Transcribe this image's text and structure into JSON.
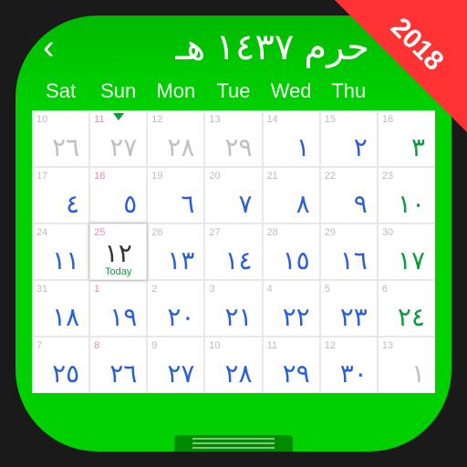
{
  "badge": {
    "year": "2018"
  },
  "header": {
    "title": "حرم ١٤٣٧ هـ"
  },
  "weekdays": [
    "Sat",
    "Sun",
    "Mon",
    "Tue",
    "Wed",
    "Thu"
  ],
  "today_label": "Today",
  "cells": [
    {
      "g": "10",
      "h": "٢٦",
      "hc": "gray"
    },
    {
      "g": "11",
      "gp": true,
      "h": "٢٧",
      "hc": "gray",
      "mark": true
    },
    {
      "g": "12",
      "h": "٢٨",
      "hc": "gray"
    },
    {
      "g": "13",
      "h": "٢٩",
      "hc": "gray"
    },
    {
      "g": "14",
      "h": "١",
      "hc": "blue"
    },
    {
      "g": "15",
      "h": "٢",
      "hc": "blue"
    },
    {
      "g": "17",
      "h": "٤",
      "hc": "blue"
    },
    {
      "g": "18",
      "gp": true,
      "h": "٥",
      "hc": "blue"
    },
    {
      "g": "19",
      "h": "٦",
      "hc": "blue"
    },
    {
      "g": "20",
      "h": "٧",
      "hc": "blue"
    },
    {
      "g": "21",
      "h": "٨",
      "hc": "blue"
    },
    {
      "g": "22",
      "h": "٩",
      "hc": "blue"
    },
    {
      "g": "24",
      "h": "١١",
      "hc": "blue"
    },
    {
      "g": "25",
      "gp": true,
      "h": "١٢",
      "hc": "black",
      "today": true
    },
    {
      "g": "26",
      "h": "١٣",
      "hc": "blue"
    },
    {
      "g": "27",
      "h": "١٤",
      "hc": "blue"
    },
    {
      "g": "28",
      "h": "١٥",
      "hc": "blue"
    },
    {
      "g": "29",
      "h": "١٦",
      "hc": "blue"
    },
    {
      "g": "31",
      "h": "١٨",
      "hc": "blue"
    },
    {
      "g": "1",
      "gp": true,
      "h": "١٩",
      "hc": "blue"
    },
    {
      "g": "2",
      "h": "٢٠",
      "hc": "blue"
    },
    {
      "g": "3",
      "h": "٢١",
      "hc": "blue"
    },
    {
      "g": "4",
      "h": "٢٢",
      "hc": "blue"
    },
    {
      "g": "5",
      "h": "٢٣",
      "hc": "blue"
    },
    {
      "g": "7",
      "h": "٢٥",
      "hc": "blue"
    },
    {
      "g": "8",
      "gp": true,
      "h": "٢٦",
      "hc": "blue"
    },
    {
      "g": "9",
      "h": "٢٧",
      "hc": "blue"
    },
    {
      "g": "10",
      "h": "٢٨",
      "hc": "blue"
    },
    {
      "g": "11",
      "h": "٢٩",
      "hc": "blue"
    },
    {
      "g": "12",
      "h": "٣٠",
      "hc": "blue"
    },
    {
      "g": "16",
      "h": "٣",
      "hc": "green"
    },
    {
      "g": "23",
      "h": "١٠",
      "hc": "green"
    },
    {
      "g": "30",
      "h": "١٧",
      "hc": "green"
    },
    {
      "g": "6",
      "h": "٢٤",
      "hc": "green"
    },
    {
      "g": "13",
      "h": "١",
      "hc": "gray"
    }
  ],
  "layout": [
    [
      0,
      1,
      2,
      3,
      4,
      5
    ],
    [
      6,
      7,
      8,
      9,
      10,
      11
    ],
    [
      12,
      13,
      14,
      15,
      16,
      17
    ],
    [
      18,
      19,
      20,
      21,
      22,
      23
    ],
    [
      24,
      25,
      26,
      27,
      28,
      29
    ],
    [
      30,
      31,
      32,
      33,
      34,
      -1
    ]
  ],
  "col6": [
    30,
    31,
    32,
    33,
    34
  ]
}
